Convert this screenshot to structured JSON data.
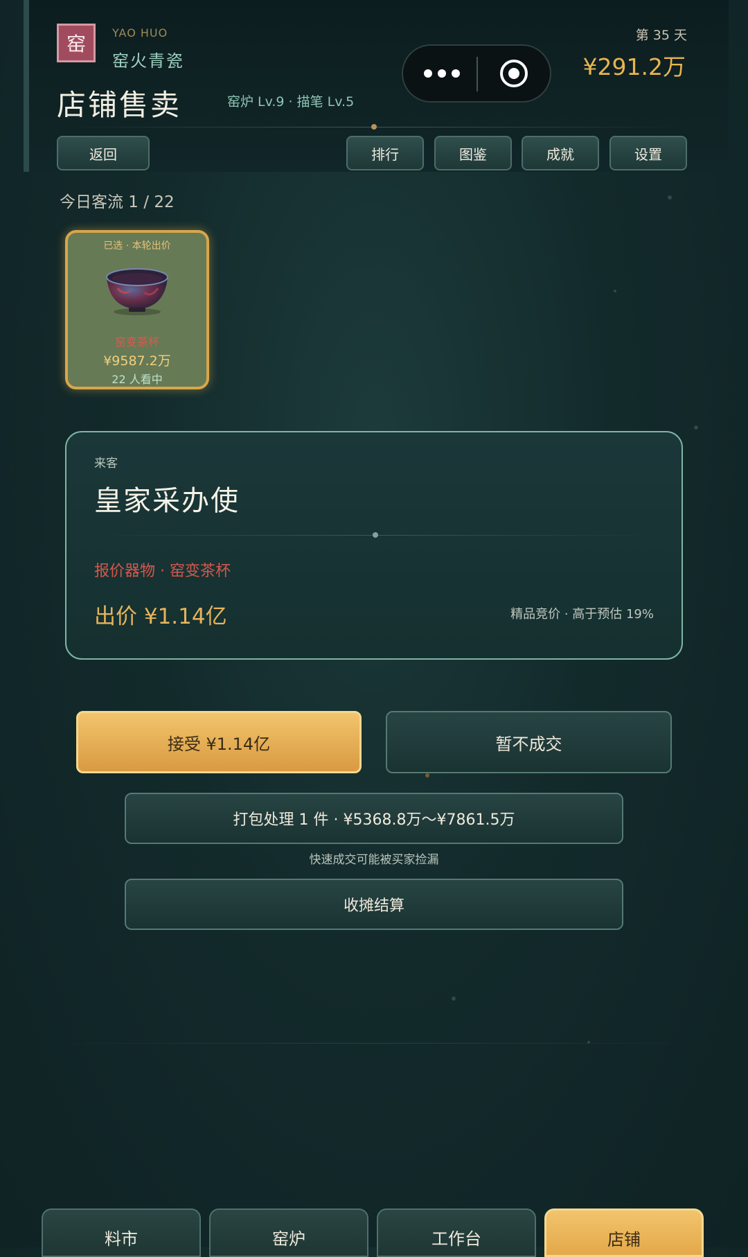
{
  "header": {
    "seal": "窑",
    "brand_en": "YAO HUO",
    "brand_cn": "窑火青瓷",
    "page_title": "店铺售卖",
    "levels": "窑炉 Lv.9 · 描笔 Lv.5",
    "day": "第 35 天",
    "money": "¥291.2万"
  },
  "toolbar": {
    "back": "返回",
    "rank": "排行",
    "catalog": "图鉴",
    "achievements": "成就",
    "settings": "设置"
  },
  "traffic": "今日客流 1 / 22",
  "item_card": {
    "status": "已选 · 本轮出价",
    "name": "窑变茶杯",
    "price": "¥9587.2万",
    "watchers": "22 人看中"
  },
  "customer": {
    "label": "来客",
    "name": "皇家采办使",
    "item": "报价器物 · 窑变茶杯",
    "offer": "出价 ¥1.14亿",
    "note": "精品竞价 · 高于预估 19%"
  },
  "actions": {
    "accept": "接受 ¥1.14亿",
    "decline": "暂不成交",
    "bundle": "打包处理 1 件 · ¥5368.8万～¥7861.5万",
    "bundle_hint": "快速成交可能被买家捡漏",
    "close_shop": "收摊结算"
  },
  "tabs": [
    {
      "label": "料市",
      "active": false
    },
    {
      "label": "窑炉",
      "active": false
    },
    {
      "label": "工作台",
      "active": false
    },
    {
      "label": "店铺",
      "active": true
    }
  ],
  "colors": {
    "accent_gold": "#e8b450",
    "price_red": "#d8564c",
    "jade": "#9ed0bf"
  }
}
